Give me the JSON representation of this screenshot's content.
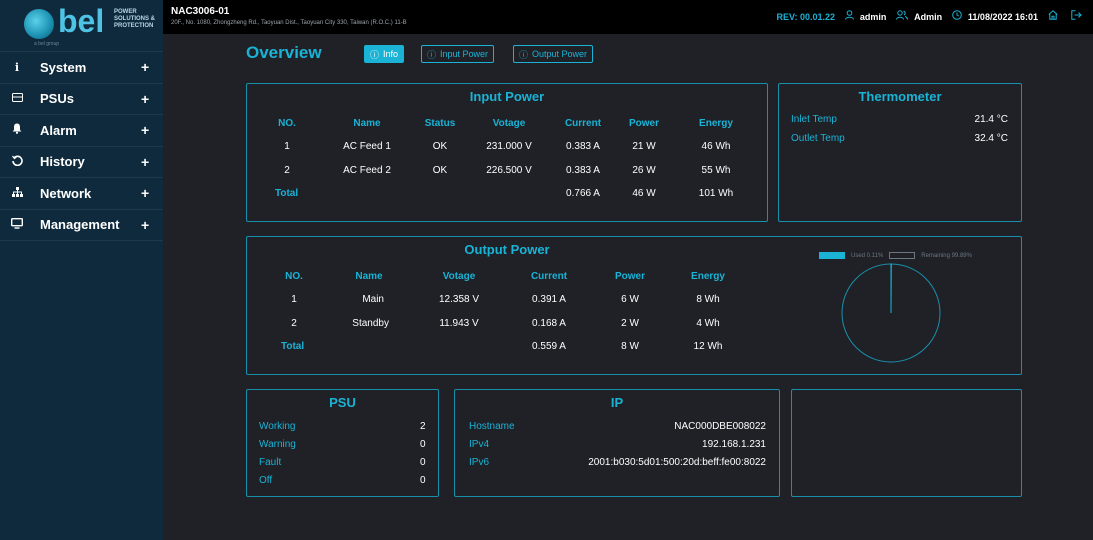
{
  "app": {
    "logo_text": "bel",
    "logo_tagline": "POWER SOLUTIONS & PROTECTION",
    "logo_sub": "a bel group"
  },
  "sidebar": {
    "items": [
      {
        "label": "System",
        "icon": "info-icon"
      },
      {
        "label": "PSUs",
        "icon": "psu-icon"
      },
      {
        "label": "Alarm",
        "icon": "bell-icon"
      },
      {
        "label": "History",
        "icon": "history-icon"
      },
      {
        "label": "Network",
        "icon": "network-icon"
      },
      {
        "label": "Management",
        "icon": "monitor-icon"
      }
    ]
  },
  "topbar": {
    "device_name": "NAC3006-01",
    "device_address": "20F., No. 1080, Zhongzheng Rd., Taoyuan Dist., Taoyuan City 330, Taiwan (R.O.C.) 11-B",
    "rev": "REV: 00.01.22",
    "user": "admin",
    "role": "Admin",
    "datetime": "11/08/2022 16:01"
  },
  "header": {
    "title": "Overview",
    "tabs": [
      "Info",
      "Input Power",
      "Output Power"
    ]
  },
  "input_power": {
    "title": "Input Power",
    "columns": [
      "NO.",
      "Name",
      "Status",
      "Votage",
      "Current",
      "Power",
      "Energy"
    ],
    "rows": [
      [
        "1",
        "AC Feed 1",
        "OK",
        "231.000 V",
        "0.383 A",
        "21 W",
        "46 Wh"
      ],
      [
        "2",
        "AC Feed 2",
        "OK",
        "226.500 V",
        "0.383 A",
        "26 W",
        "55 Wh"
      ]
    ],
    "total": {
      "label": "Total",
      "current": "0.766 A",
      "power": "46 W",
      "energy": "101 Wh"
    }
  },
  "thermometer": {
    "title": "Thermometer",
    "rows": [
      {
        "label": "Inlet Temp",
        "value": "21.4 °C"
      },
      {
        "label": "Outlet Temp",
        "value": "32.4 °C"
      }
    ]
  },
  "output_power": {
    "title": "Output Power",
    "columns": [
      "NO.",
      "Name",
      "Votage",
      "Current",
      "Power",
      "Energy"
    ],
    "rows": [
      [
        "1",
        "Main",
        "12.358 V",
        "0.391 A",
        "6 W",
        "8 Wh"
      ],
      [
        "2",
        "Standby",
        "11.943 V",
        "0.168 A",
        "2 W",
        "4 Wh"
      ]
    ],
    "total": {
      "label": "Total",
      "current": "0.559 A",
      "power": "8 W",
      "energy": "12 Wh"
    }
  },
  "usage": {
    "used_label": "Used 0.11%",
    "remaining_label": "Remaining 99.89%",
    "used_fraction": 0.0011,
    "colors": {
      "used": "#1ab3d6",
      "ring": "#1a8fab"
    }
  },
  "psu": {
    "title": "PSU",
    "rows": [
      {
        "label": "Working",
        "value": "2"
      },
      {
        "label": "Warning",
        "value": "0"
      },
      {
        "label": "Fault",
        "value": "0"
      },
      {
        "label": "Off",
        "value": "0"
      }
    ]
  },
  "ip": {
    "title": "IP",
    "rows": [
      {
        "label": "Hostname",
        "value": "NAC000DBE008022"
      },
      {
        "label": "IPv4",
        "value": "192.168.1.231"
      },
      {
        "label": "IPv6",
        "value": "2001:b030:5d01:500:20d:beff:fe00:8022"
      }
    ]
  },
  "colors": {
    "accent": "#1ab3d6",
    "sidebar": "#0f2a3d",
    "background": "#1f2127",
    "topbar": "#000000"
  }
}
